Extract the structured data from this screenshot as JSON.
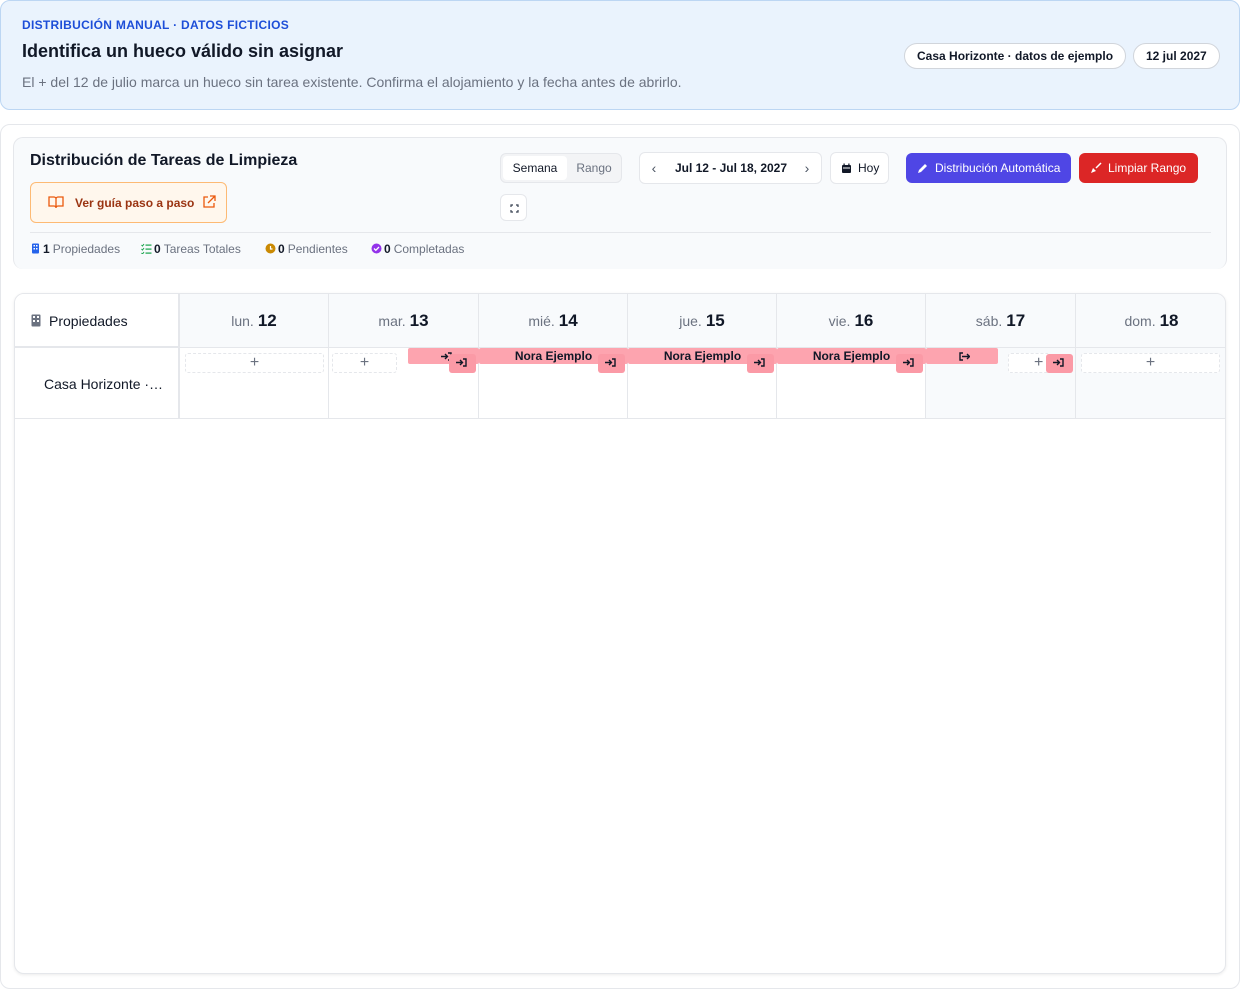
{
  "banner": {
    "kicker": "DISTRIBUCIÓN MANUAL · DATOS FICTICIOS",
    "title": "Identifica un hueco válido sin asignar",
    "description": "El + del 12 de julio marca un hueco sin tarea existente. Confirma el alojamiento y la fecha antes de abrirlo.",
    "property_pill": "Casa Horizonte · datos de ejemplo",
    "date_pill": "12 jul 2027"
  },
  "header": {
    "title": "Distribución de Tareas de Limpieza",
    "guide_label": "Ver guía paso a paso",
    "view_modes": [
      "Semana",
      "Rango"
    ],
    "active_view": "Semana",
    "date_range": "Jul 12 - Jul 18, 2027",
    "today_label": "Hoy",
    "auto_label": "Distribución Automática",
    "clear_label": "Limpiar Rango",
    "colors": {
      "auto": "#4f46e5",
      "clear": "#dc2626",
      "guide": "#9a3412"
    }
  },
  "stats": [
    {
      "value": "1",
      "label": "Propiedades",
      "icon": "building-icon"
    },
    {
      "value": "0",
      "label": "Tareas Totales",
      "icon": "list-check-icon"
    },
    {
      "value": "0",
      "label": "Pendientes",
      "icon": "clock-icon"
    },
    {
      "value": "0",
      "label": "Completadas",
      "icon": "check-circle-icon"
    }
  ],
  "calendar": {
    "corner_label": "Propiedades",
    "days": [
      {
        "name": "lun.",
        "num": "12"
      },
      {
        "name": "mar.",
        "num": "13"
      },
      {
        "name": "mié.",
        "num": "14"
      },
      {
        "name": "jue.",
        "num": "15"
      },
      {
        "name": "vie.",
        "num": "16"
      },
      {
        "name": "sáb.",
        "num": "17"
      },
      {
        "name": "dom.",
        "num": "18"
      }
    ],
    "property_name": "Casa Horizonte ·…",
    "add_symbol": "+",
    "reservations": [
      {
        "guest": "Nora Ejemplo",
        "day": "mié."
      },
      {
        "guest": "Nora Ejemplo",
        "day": "jue."
      },
      {
        "guest": "Nora Ejemplo",
        "day": "vie."
      }
    ],
    "reservation_color": "#fda4af"
  }
}
